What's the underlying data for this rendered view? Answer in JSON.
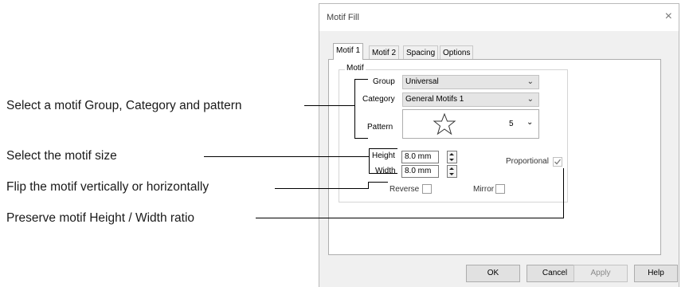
{
  "annotations": [
    {
      "text": "Select a motif Group, Category and pattern"
    },
    {
      "text": "Select the motif size"
    },
    {
      "text": "Flip the motif vertically or horizontally"
    },
    {
      "text": "Preserve motif Height / Width ratio"
    }
  ],
  "dialog": {
    "title": "Motif Fill",
    "close_glyph": "×",
    "tabs": [
      {
        "label": "Motif 1",
        "active": true
      },
      {
        "label": "Motif 2",
        "active": false
      },
      {
        "label": "Spacing",
        "active": false
      },
      {
        "label": "Options",
        "active": false
      }
    ],
    "motif_group": {
      "legend": "Motif",
      "group": {
        "label": "Group",
        "value": "Universal"
      },
      "category": {
        "label": "Category",
        "value": "General Motifs 1"
      },
      "pattern": {
        "label": "Pattern",
        "number": "5",
        "icon": "star-outline-icon"
      },
      "height": {
        "label": "Height",
        "value": "8.0 mm"
      },
      "width": {
        "label": "Width",
        "value": "8.0 mm"
      },
      "proportional": {
        "label": "Proportional",
        "checked": true
      },
      "reverse": {
        "label": "Reverse",
        "checked": false
      },
      "mirror": {
        "label": "Mirror",
        "checked": false
      }
    },
    "buttons": {
      "ok": "OK",
      "cancel": "Cancel",
      "apply": "Apply",
      "help": "Help"
    }
  }
}
